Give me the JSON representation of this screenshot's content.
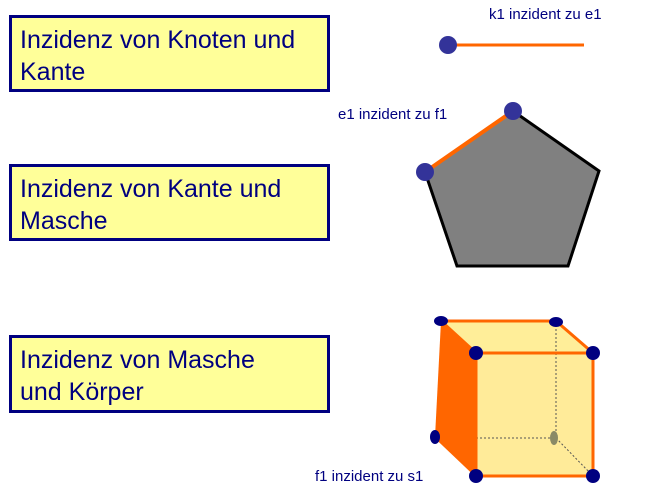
{
  "boxes": [
    {
      "line1": "Inzidenz von Knoten und",
      "line2": "Kante"
    },
    {
      "line1": "Inzidenz von Kante und",
      "line2": "Masche"
    },
    {
      "line1": "Inzidenz von Masche",
      "line2": "und Körper"
    }
  ],
  "captions": {
    "vertex_edge": "k1 inzident zu e1",
    "edge_face": "e1 inzident zu f1",
    "face_solid": "f1 inzident zu s1"
  },
  "colors": {
    "text": "#000080",
    "box_fill": "#ffff99",
    "edge_highlight": "#ff6600",
    "vertex": "#333399",
    "pentagon_fill": "#808080",
    "cube_fill": "#ffee99"
  }
}
